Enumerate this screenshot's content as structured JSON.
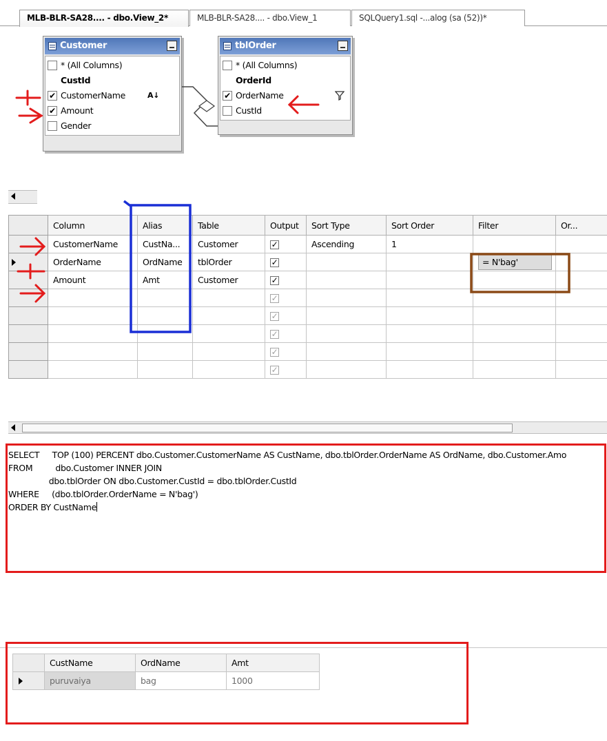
{
  "tabs": [
    {
      "label": "MLB-BLR-SA28.... - dbo.View_2*",
      "active": true
    },
    {
      "label": "MLB-BLR-SA28.... - dbo.View_1",
      "active": false
    },
    {
      "label": "SQLQuery1.sql -...alog (sa (52))*",
      "active": false
    }
  ],
  "diagram": {
    "tables": [
      {
        "name": "Customer",
        "columns": [
          {
            "label": "* (All Columns)",
            "checked": false,
            "key": false
          },
          {
            "label": "CustId",
            "checked": null,
            "key": true
          },
          {
            "label": "CustomerName",
            "checked": true,
            "key": false,
            "sort_icon": "sort-ascending-icon",
            "sort_text": "A↓"
          },
          {
            "label": "Amount",
            "checked": true,
            "key": false
          },
          {
            "label": "Gender",
            "checked": false,
            "key": false
          }
        ]
      },
      {
        "name": "tblOrder",
        "columns": [
          {
            "label": "* (All Columns)",
            "checked": false,
            "key": false
          },
          {
            "label": "OrderId",
            "checked": null,
            "key": true
          },
          {
            "label": "OrderName",
            "checked": true,
            "key": false,
            "filter_icon": "filter-funnel-icon"
          },
          {
            "label": "CustId",
            "checked": false,
            "key": false
          }
        ]
      }
    ]
  },
  "criteria": {
    "headers": [
      "Column",
      "Alias",
      "Table",
      "Output",
      "Sort Type",
      "Sort Order",
      "Filter",
      "Or..."
    ],
    "rows": [
      {
        "column": "CustomerName",
        "alias": "CustNa...",
        "table": "Customer",
        "output": true,
        "sort_type": "Ascending",
        "sort_order": "1",
        "filter": ""
      },
      {
        "column": "OrderName",
        "alias": "OrdName",
        "table": "tblOrder",
        "output": true,
        "sort_type": "",
        "sort_order": "",
        "filter": "= N'bag'",
        "current": true
      },
      {
        "column": "Amount",
        "alias": "Amt",
        "table": "Customer",
        "output": true,
        "sort_type": "",
        "sort_order": "",
        "filter": ""
      },
      {
        "column": "",
        "alias": "",
        "table": "",
        "output": true,
        "dim": true
      },
      {
        "column": "",
        "alias": "",
        "table": "",
        "output": true,
        "dim": true
      },
      {
        "column": "",
        "alias": "",
        "table": "",
        "output": true,
        "dim": true
      },
      {
        "column": "",
        "alias": "",
        "table": "",
        "output": true,
        "dim": true
      },
      {
        "column": "",
        "alias": "",
        "table": "",
        "output": true,
        "dim": true
      }
    ]
  },
  "sql": {
    "line1": "SELECT     TOP (100) PERCENT dbo.Customer.CustomerName AS CustName, dbo.tblOrder.OrderName AS OrdName, dbo.Customer.Amo",
    "line2": "FROM         dbo.Customer INNER JOIN",
    "line3": "                dbo.tblOrder ON dbo.Customer.CustId = dbo.tblOrder.CustId",
    "line4": "WHERE     (dbo.tblOrder.OrderName = N'bag')",
    "line5": "ORDER BY CustName"
  },
  "results": {
    "headers": [
      "CustName",
      "OrdName",
      "Amt"
    ],
    "rows": [
      {
        "values": [
          "puruvaiya",
          "bag",
          "1000"
        ],
        "current": true
      }
    ]
  },
  "colors": {
    "annotation_red": "#e31c1c",
    "annotation_blue": "#1a2fd6",
    "annotation_brown": "#8b4a17",
    "title_bar": "#5a80c0"
  }
}
